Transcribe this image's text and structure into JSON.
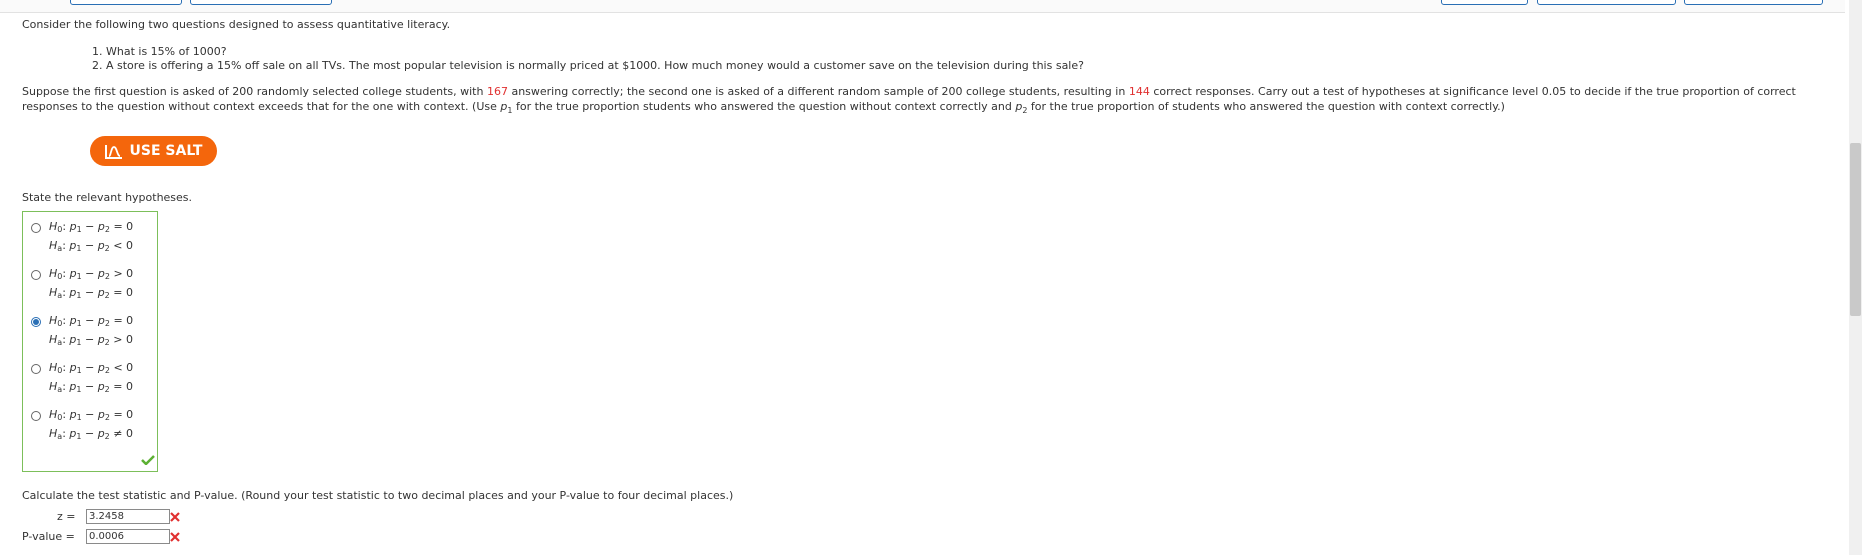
{
  "intro": "Consider the following two questions designed to assess quantitative literacy.",
  "questions": [
    "1. What is 15% of 1000?",
    "2. A store is offering a 15% off sale on all TVs. The most popular television is normally priced at $1000. How much money would a customer save on the television during this sale?"
  ],
  "scenario": {
    "line1_a": "Suppose the first question is asked of 200 randomly selected college students, with ",
    "num1": "167",
    "line1_b": " answering correctly; the second one is asked of a different random sample of 200 college students, resulting in ",
    "num2": "144",
    "line1_c": " correct responses. Carry out a test of hypotheses at significance level 0.05 to decide if the true proportion of correct",
    "line2_a": "responses to the question without context exceeds that for the one with context. (Use ",
    "p1": "p",
    "p1_sub": "1",
    "line2_b": " for the true proportion students who answered the question without context correctly and ",
    "p2": "p",
    "p2_sub": "2",
    "line2_c": " for the true proportion of students who answered the question with context correctly.)"
  },
  "salt_button": "USE SALT",
  "hypotheses_prompt": "State the relevant hypotheses.",
  "options": [
    {
      "h0": "p1 − p2 = 0",
      "ha": "p1 − p2 < 0",
      "selected": false
    },
    {
      "h0": "p1 − p2 > 0",
      "ha": "p1 − p2 = 0",
      "selected": false
    },
    {
      "h0": "p1 − p2 = 0",
      "ha": "p1 − p2 > 0",
      "selected": true
    },
    {
      "h0": "p1 − p2 < 0",
      "ha": "p1 − p2 = 0",
      "selected": false
    },
    {
      "h0": "p1 − p2 = 0",
      "ha": "p1 − p2 ≠ 0",
      "selected": false
    }
  ],
  "h0_label": "H0:",
  "ha_label": "Ha:",
  "calc_prompt": "Calculate the test statistic and P-value. (Round your test statistic to two decimal places and your P-value to four decimal places.)",
  "z_label": "z =",
  "z_value": "3.2458",
  "p_label": "P-value =",
  "p_value": "0.0006",
  "colors": {
    "accent": "#f4660c",
    "correct": "#5cb033",
    "incorrect": "#e03030",
    "link": "#2a6fb5"
  },
  "icons": {
    "salt": "salt-chart-icon",
    "check": "check-icon",
    "wrong": "x-icon"
  }
}
